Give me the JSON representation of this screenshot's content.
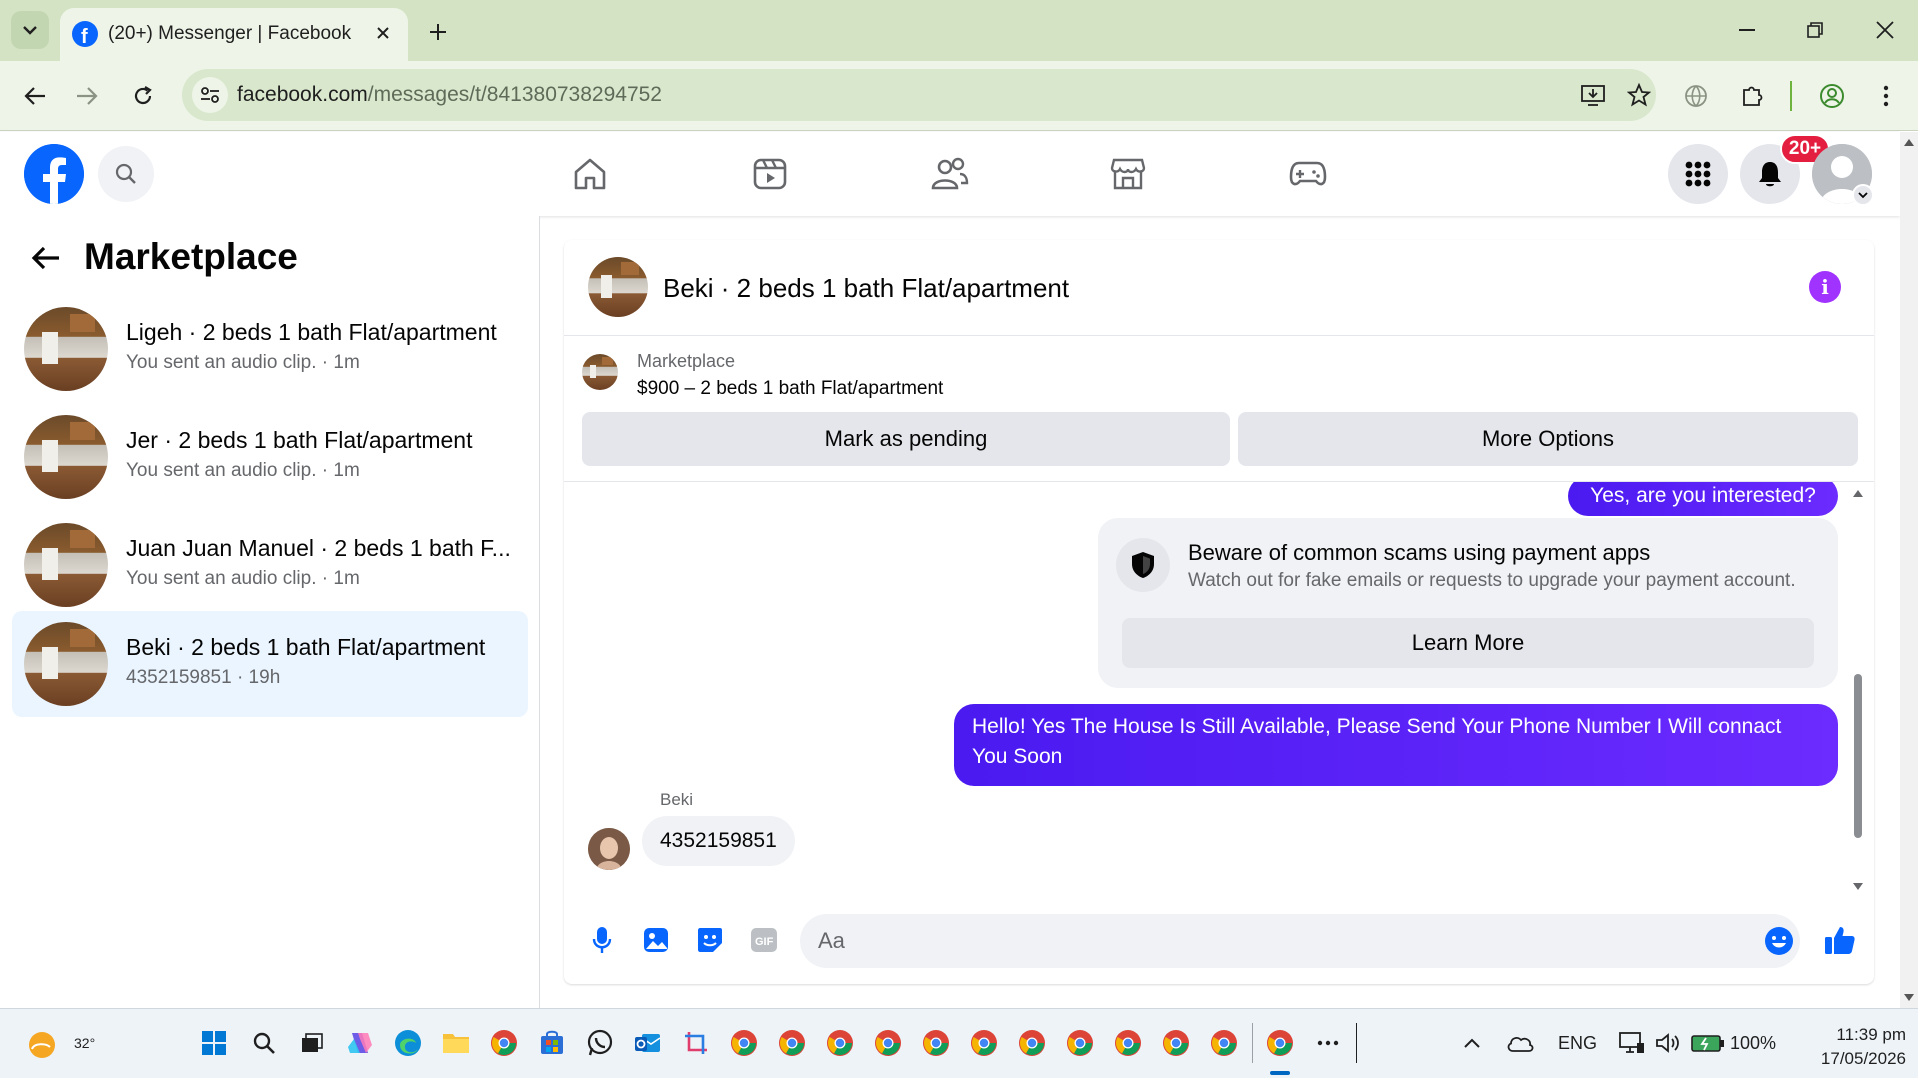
{
  "browser": {
    "tab_title": "(20+) Messenger | Facebook",
    "url_host": "facebook.com",
    "url_path": "/messages/t/841380738294752"
  },
  "fb": {
    "notification_count": "20+"
  },
  "sidebar": {
    "title": "Marketplace",
    "conversations": [
      {
        "name": "Ligeh · 2 beds 1 bath Flat/apartment",
        "sub": "You sent an audio clip. · 1m"
      },
      {
        "name": "Jer · 2 beds 1 bath Flat/apartment",
        "sub": "You sent an audio clip. · 1m"
      },
      {
        "name": "Juan Juan Manuel · 2 beds 1 bath F...",
        "sub": "You sent an audio clip. · 1m"
      },
      {
        "name": "Beki · 2 beds 1 bath Flat/apartment",
        "sub": "4352159851 · 19h"
      }
    ]
  },
  "chat": {
    "title": "Beki · 2 beds 1 bath Flat/apartment",
    "listing_label": "Marketplace",
    "listing_title": "$900 – 2 beds 1 bath Flat/apartment",
    "mark_pending": "Mark as pending",
    "more_options": "More Options",
    "msg_top": "Yes, are you interested?",
    "scam_title": "Beware of common scams using payment apps",
    "scam_sub": "Watch out for fake emails or requests to upgrade your payment account.",
    "learn_more": "Learn More",
    "msg_out": "Hello! Yes The House  Is Still Available, Please Send Your Phone Number I Will connact You Soon",
    "sender": "Beki",
    "msg_in": "4352159851",
    "composer_placeholder": "Aa"
  },
  "taskbar": {
    "temperature": "32°",
    "lang": "ENG",
    "battery": "100%",
    "time": "11:39 pm",
    "date": "17/05/2026"
  },
  "colors": {
    "fb_blue": "#0866ff",
    "messenger_purple": "#5b1cff",
    "badge_red": "#e41e3f"
  }
}
